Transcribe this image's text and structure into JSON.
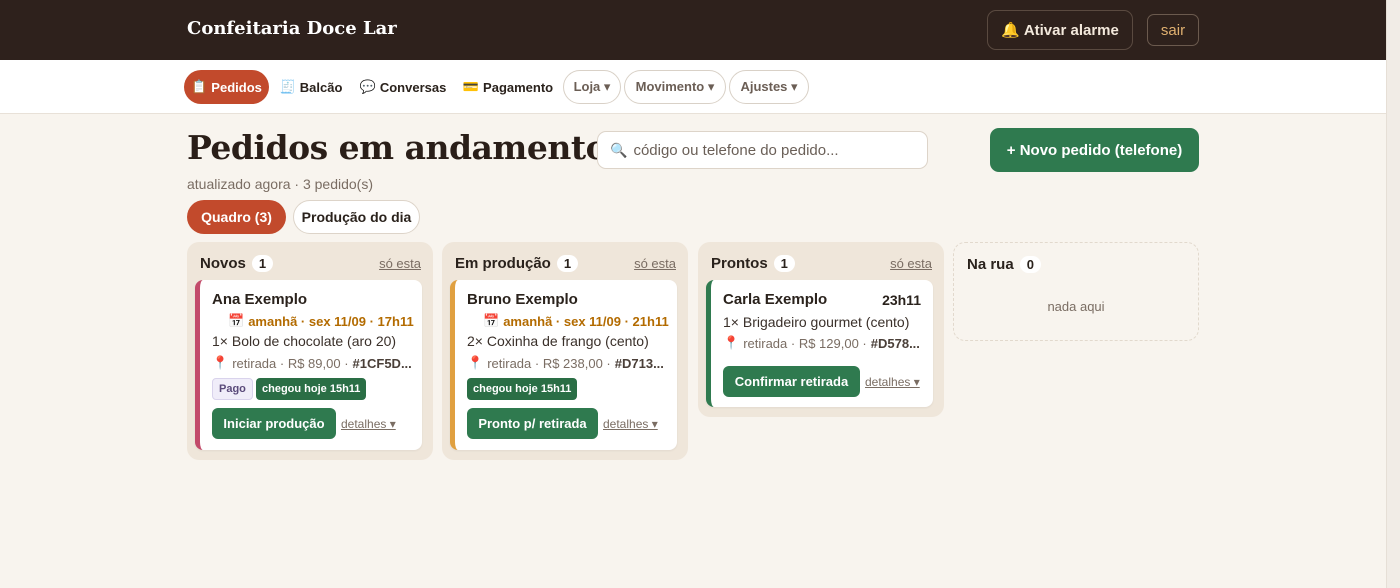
{
  "header": {
    "brand": "Confeitaria Doce Lar",
    "alarm_icon": "🔔",
    "alarm_label": "Ativar alarme",
    "exit_label": "sair"
  },
  "nav": [
    {
      "icon": "📋",
      "label": "Pedidos",
      "icon_name": "clipboard-icon"
    },
    {
      "icon": "🧾",
      "label": "Balcão",
      "icon_name": "receipt-icon"
    },
    {
      "icon": "💬",
      "label": "Conversas",
      "icon_name": "speech-bubble-icon"
    },
    {
      "icon": "💳",
      "label": "Pagamento",
      "icon_name": "credit-card-icon"
    },
    {
      "label": "Loja ▾"
    },
    {
      "label": "Movimento ▾"
    },
    {
      "label": "Ajustes ▾"
    }
  ],
  "page": {
    "title": "Pedidos em andamento",
    "subtitle": "atualizado agora · 3 pedido(s)",
    "search_placeholder": "código ou telefone do pedido...",
    "new_order_label": "+  Novo pedido (telefone)"
  },
  "view_tabs": {
    "board": "Quadro  (3)",
    "production": "Produção do dia"
  },
  "columns": [
    {
      "title": "Novos",
      "count": "1",
      "only_label": "só esta",
      "card": {
        "name": "Ana Exemplo",
        "date": "amanhã · sex 11/09 · 17h11",
        "item": "1× Bolo de chocolate (aro 20)",
        "meta_place": "retirada · R$ 89,00 ·",
        "meta_code": "#1CF5D...",
        "badge_paid": "Pago",
        "badge_arrival": "chegou hoje 15h11",
        "action": "Iniciar produção",
        "details": "detalhes ▾"
      }
    },
    {
      "title": "Em produção",
      "count": "1",
      "only_label": "só esta",
      "card": {
        "name": "Bruno Exemplo",
        "date": "amanhã · sex 11/09 · 21h11",
        "item": "2× Coxinha de frango (cento)",
        "meta_place": "retirada · R$ 238,00 ·",
        "meta_code": "#D713...",
        "badge_arrival": "chegou hoje 15h11",
        "action": "Pronto p/ retirada",
        "details": "detalhes ▾"
      }
    },
    {
      "title": "Prontos",
      "count": "1",
      "only_label": "só esta",
      "card": {
        "name": "Carla Exemplo",
        "time": "23h11",
        "item": "1× Brigadeiro gourmet (cento)",
        "meta_place": "retirada · R$ 129,00 ·",
        "meta_code": "#D578...",
        "action": "Confirmar retirada",
        "details": "detalhes ▾"
      }
    },
    {
      "title": "Na rua",
      "count": "0",
      "empty_text": "nada aqui"
    }
  ],
  "colors": {
    "accent": "#c24a2c",
    "primary_green": "#2f7a4f",
    "header_bg": "#2e211c",
    "new_border": "#c24a6a",
    "production_border": "#e0a040",
    "ready_border": "#2f7a4f"
  }
}
